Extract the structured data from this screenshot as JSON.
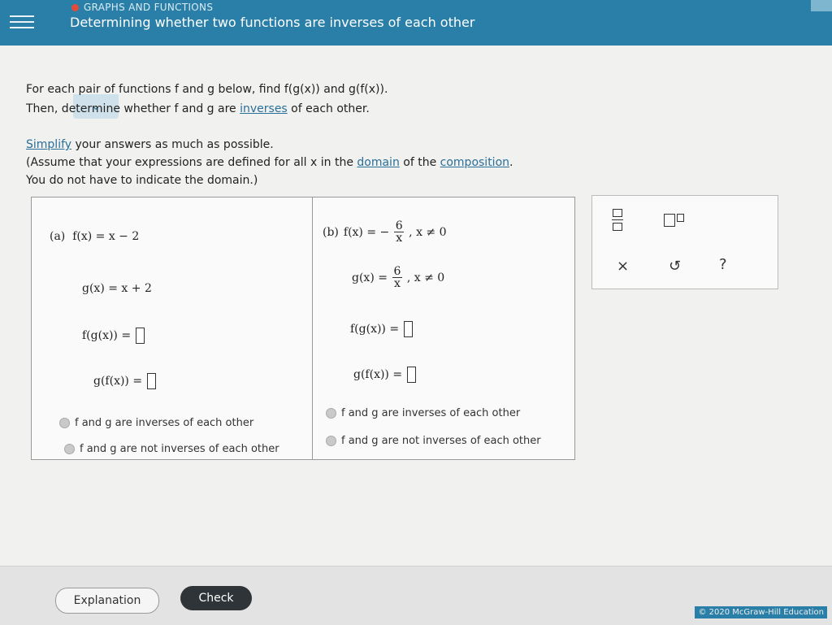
{
  "header": {
    "topic": "GRAPHS AND FUNCTIONS",
    "title": "Determining whether two functions are inverses of each other"
  },
  "instructions": {
    "line1": "For each pair of functions f and g below, find f(g(x)) and g(f(x)).",
    "line2_before": "Then, determine whether f and g are ",
    "line2_link": "inverses",
    "line2_after": " of each other.",
    "simplify_link": "Simplify",
    "simplify_after": " your answers as much as possible.",
    "assume_before": "(Assume that your expressions are defined for all x in the ",
    "domain_link": "domain",
    "assume_mid": " of the ",
    "composition_link": "composition",
    "assume_after": ".",
    "domain_note": "You do not have to indicate the domain.)"
  },
  "part_a": {
    "label": "(a)",
    "f": "f(x) = x − 2",
    "g": "g(x) = x + 2",
    "fg": "f(g(x)) =",
    "gf": "g(f(x)) =",
    "opt_yes": "f and g are inverses of each other",
    "opt_no": "f and g are not inverses of each other"
  },
  "part_b": {
    "label": "(b)",
    "f_lhs": "f(x) = −",
    "f_num": "6",
    "f_den": "x",
    "f_cond": ", x ≠ 0",
    "g_lhs": "g(x) =",
    "g_num": "6",
    "g_den": "x",
    "g_cond": ", x ≠ 0",
    "fg": "f(g(x)) =",
    "gf": "g(f(x)) =",
    "opt_yes": "f and g are inverses of each other",
    "opt_no": "f and g are not inverses of each other"
  },
  "toolbox": {
    "fraction_icon": "fraction-icon",
    "exponent_icon": "exponent-icon",
    "clear": "×",
    "undo": "↺",
    "help": "?"
  },
  "footer": {
    "explanation": "Explanation",
    "check": "Check",
    "copyright": "© 2020 McGraw-Hill Education"
  }
}
